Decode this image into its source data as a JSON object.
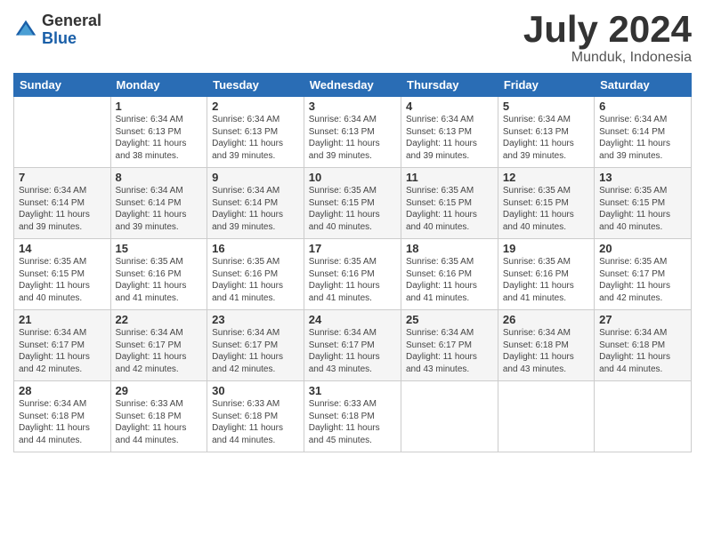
{
  "header": {
    "logo_general": "General",
    "logo_blue": "Blue",
    "month_title": "July 2024",
    "location": "Munduk, Indonesia"
  },
  "days_of_week": [
    "Sunday",
    "Monday",
    "Tuesday",
    "Wednesday",
    "Thursday",
    "Friday",
    "Saturday"
  ],
  "weeks": [
    [
      {
        "day": "",
        "info": ""
      },
      {
        "day": "1",
        "info": "Sunrise: 6:34 AM\nSunset: 6:13 PM\nDaylight: 11 hours\nand 38 minutes."
      },
      {
        "day": "2",
        "info": "Sunrise: 6:34 AM\nSunset: 6:13 PM\nDaylight: 11 hours\nand 39 minutes."
      },
      {
        "day": "3",
        "info": "Sunrise: 6:34 AM\nSunset: 6:13 PM\nDaylight: 11 hours\nand 39 minutes."
      },
      {
        "day": "4",
        "info": "Sunrise: 6:34 AM\nSunset: 6:13 PM\nDaylight: 11 hours\nand 39 minutes."
      },
      {
        "day": "5",
        "info": "Sunrise: 6:34 AM\nSunset: 6:13 PM\nDaylight: 11 hours\nand 39 minutes."
      },
      {
        "day": "6",
        "info": "Sunrise: 6:34 AM\nSunset: 6:14 PM\nDaylight: 11 hours\nand 39 minutes."
      }
    ],
    [
      {
        "day": "7",
        "info": "Sunrise: 6:34 AM\nSunset: 6:14 PM\nDaylight: 11 hours\nand 39 minutes."
      },
      {
        "day": "8",
        "info": "Sunrise: 6:34 AM\nSunset: 6:14 PM\nDaylight: 11 hours\nand 39 minutes."
      },
      {
        "day": "9",
        "info": "Sunrise: 6:34 AM\nSunset: 6:14 PM\nDaylight: 11 hours\nand 39 minutes."
      },
      {
        "day": "10",
        "info": "Sunrise: 6:35 AM\nSunset: 6:15 PM\nDaylight: 11 hours\nand 40 minutes."
      },
      {
        "day": "11",
        "info": "Sunrise: 6:35 AM\nSunset: 6:15 PM\nDaylight: 11 hours\nand 40 minutes."
      },
      {
        "day": "12",
        "info": "Sunrise: 6:35 AM\nSunset: 6:15 PM\nDaylight: 11 hours\nand 40 minutes."
      },
      {
        "day": "13",
        "info": "Sunrise: 6:35 AM\nSunset: 6:15 PM\nDaylight: 11 hours\nand 40 minutes."
      }
    ],
    [
      {
        "day": "14",
        "info": "Sunrise: 6:35 AM\nSunset: 6:15 PM\nDaylight: 11 hours\nand 40 minutes."
      },
      {
        "day": "15",
        "info": "Sunrise: 6:35 AM\nSunset: 6:16 PM\nDaylight: 11 hours\nand 41 minutes."
      },
      {
        "day": "16",
        "info": "Sunrise: 6:35 AM\nSunset: 6:16 PM\nDaylight: 11 hours\nand 41 minutes."
      },
      {
        "day": "17",
        "info": "Sunrise: 6:35 AM\nSunset: 6:16 PM\nDaylight: 11 hours\nand 41 minutes."
      },
      {
        "day": "18",
        "info": "Sunrise: 6:35 AM\nSunset: 6:16 PM\nDaylight: 11 hours\nand 41 minutes."
      },
      {
        "day": "19",
        "info": "Sunrise: 6:35 AM\nSunset: 6:16 PM\nDaylight: 11 hours\nand 41 minutes."
      },
      {
        "day": "20",
        "info": "Sunrise: 6:35 AM\nSunset: 6:17 PM\nDaylight: 11 hours\nand 42 minutes."
      }
    ],
    [
      {
        "day": "21",
        "info": "Sunrise: 6:34 AM\nSunset: 6:17 PM\nDaylight: 11 hours\nand 42 minutes."
      },
      {
        "day": "22",
        "info": "Sunrise: 6:34 AM\nSunset: 6:17 PM\nDaylight: 11 hours\nand 42 minutes."
      },
      {
        "day": "23",
        "info": "Sunrise: 6:34 AM\nSunset: 6:17 PM\nDaylight: 11 hours\nand 42 minutes."
      },
      {
        "day": "24",
        "info": "Sunrise: 6:34 AM\nSunset: 6:17 PM\nDaylight: 11 hours\nand 43 minutes."
      },
      {
        "day": "25",
        "info": "Sunrise: 6:34 AM\nSunset: 6:17 PM\nDaylight: 11 hours\nand 43 minutes."
      },
      {
        "day": "26",
        "info": "Sunrise: 6:34 AM\nSunset: 6:18 PM\nDaylight: 11 hours\nand 43 minutes."
      },
      {
        "day": "27",
        "info": "Sunrise: 6:34 AM\nSunset: 6:18 PM\nDaylight: 11 hours\nand 44 minutes."
      }
    ],
    [
      {
        "day": "28",
        "info": "Sunrise: 6:34 AM\nSunset: 6:18 PM\nDaylight: 11 hours\nand 44 minutes."
      },
      {
        "day": "29",
        "info": "Sunrise: 6:33 AM\nSunset: 6:18 PM\nDaylight: 11 hours\nand 44 minutes."
      },
      {
        "day": "30",
        "info": "Sunrise: 6:33 AM\nSunset: 6:18 PM\nDaylight: 11 hours\nand 44 minutes."
      },
      {
        "day": "31",
        "info": "Sunrise: 6:33 AM\nSunset: 6:18 PM\nDaylight: 11 hours\nand 45 minutes."
      },
      {
        "day": "",
        "info": ""
      },
      {
        "day": "",
        "info": ""
      },
      {
        "day": "",
        "info": ""
      }
    ]
  ]
}
